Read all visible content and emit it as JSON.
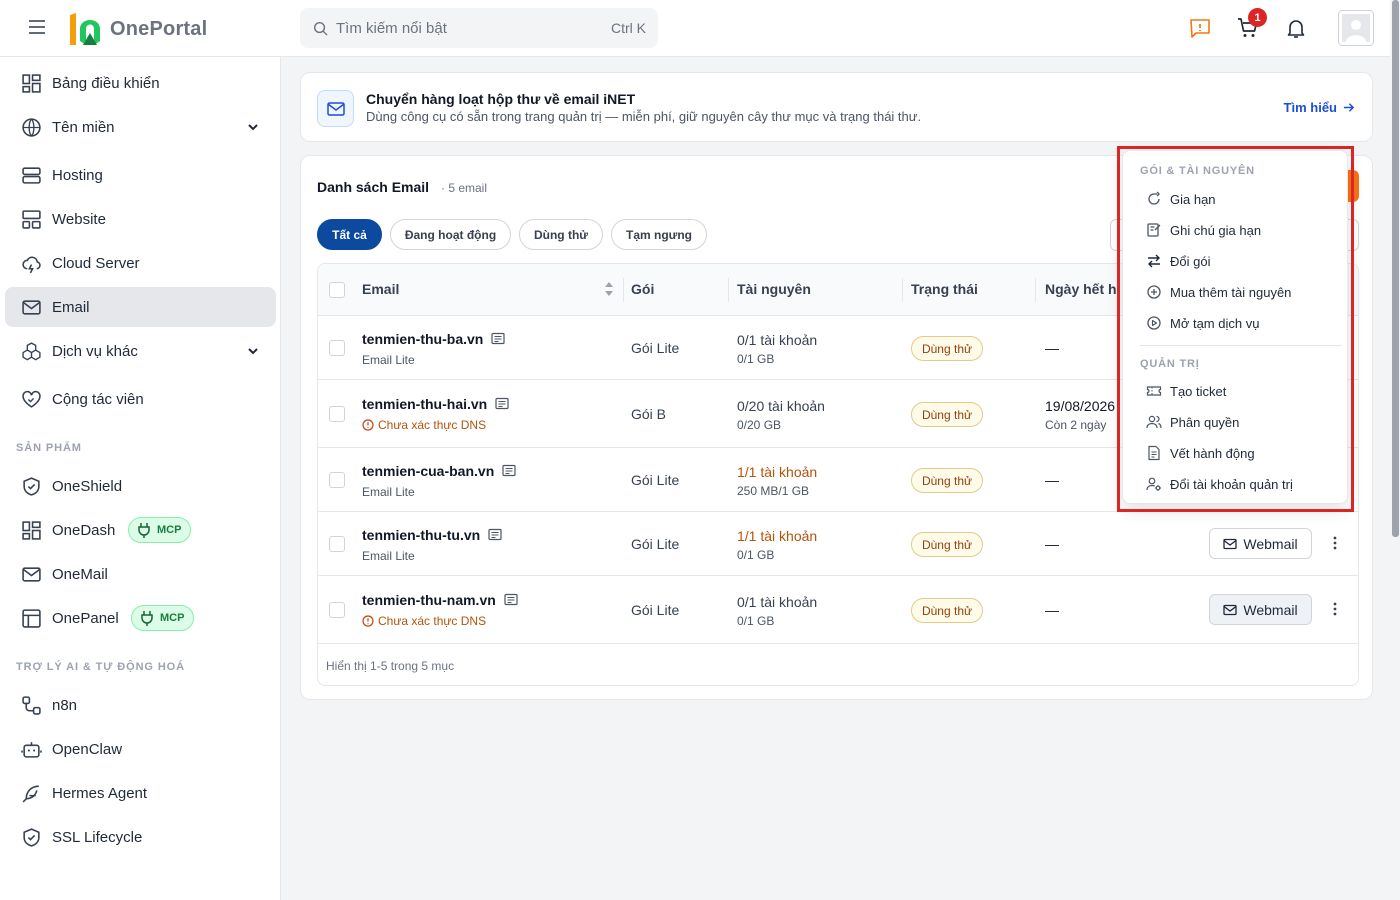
{
  "header": {
    "app_name": "OnePortal",
    "search_placeholder": "Tìm kiếm nổi bật",
    "search_shortcut": "Ctrl K",
    "cart_badge": "1"
  },
  "sidebar": {
    "items": [
      {
        "label": "Bảng điều khiển"
      },
      {
        "label": "Tên miền"
      },
      {
        "label": "Hosting"
      },
      {
        "label": "Website"
      },
      {
        "label": "Cloud Server"
      },
      {
        "label": "Email"
      },
      {
        "label": "Dịch vụ khác"
      },
      {
        "label": "Cộng tác viên"
      }
    ],
    "section_products": "SẢN PHẨM",
    "products": [
      {
        "label": "OneShield"
      },
      {
        "label": "OneDash",
        "badge": "MCP"
      },
      {
        "label": "OneMail"
      },
      {
        "label": "OnePanel",
        "badge": "MCP"
      }
    ],
    "section_ai": "TRỢ LÝ AI & TỰ ĐỘNG HOÁ",
    "ai": [
      {
        "label": "n8n"
      },
      {
        "label": "OpenClaw"
      },
      {
        "label": "Hermes Agent"
      },
      {
        "label": "SSL Lifecycle"
      }
    ]
  },
  "banner": {
    "title": "Chuyển hàng loạt hộp thư về email iNET",
    "desc": "Dùng công cụ có sẵn trong trang quản trị — miễn phí, giữ nguyên cây thư mục và trạng thái thư.",
    "link": "Tìm hiểu"
  },
  "list": {
    "title": "Danh sách Email",
    "count": "· 5 email",
    "filters": [
      "Tất cả",
      "Đang hoạt động",
      "Dùng thử",
      "Tạm ngưng"
    ],
    "columns": [
      "Email",
      "Gói",
      "Tài nguyên",
      "Trạng thái",
      "Ngày hết h"
    ],
    "rows": [
      {
        "domain": "tenmien-thu-ba.vn",
        "sub": "Email Lite",
        "warn": false,
        "plan": "Gói Lite",
        "res1": "0/1 tài khoản",
        "res1_warn": false,
        "res2": "0/1 GB",
        "status": "Dùng thử",
        "exp1": "—",
        "exp2": ""
      },
      {
        "domain": "tenmien-thu-hai.vn",
        "sub": "Chưa xác thực DNS",
        "warn": true,
        "plan": "Gói B",
        "res1": "0/20 tài khoản",
        "res1_warn": false,
        "res2": "0/20 GB",
        "status": "Dùng thử",
        "exp1": "19/08/2026",
        "exp2": "Còn 2 ngày"
      },
      {
        "domain": "tenmien-cua-ban.vn",
        "sub": "Email Lite",
        "warn": false,
        "plan": "Gói Lite",
        "res1": "1/1 tài khoản",
        "res1_warn": true,
        "res2": "250 MB/1 GB",
        "status": "Dùng thử",
        "exp1": "—",
        "exp2": ""
      },
      {
        "domain": "tenmien-thu-tu.vn",
        "sub": "Email Lite",
        "warn": false,
        "plan": "Gói Lite",
        "res1": "1/1 tài khoản",
        "res1_warn": true,
        "res2": "0/1 GB",
        "status": "Dùng thử",
        "exp1": "—",
        "exp2": ""
      },
      {
        "domain": "tenmien-thu-nam.vn",
        "sub": "Chưa xác thực DNS",
        "warn": true,
        "plan": "Gói Lite",
        "res1": "0/1 tài khoản",
        "res1_warn": false,
        "res2": "0/1 GB",
        "status": "Dùng thử",
        "exp1": "—",
        "exp2": ""
      }
    ],
    "webmail_label": "Webmail",
    "footer": "Hiển thị 1-5 trong 5 mục"
  },
  "menu": {
    "section1": "GÓI & TÀI NGUYÊN",
    "items1": [
      "Gia hạn",
      "Ghi chú gia hạn",
      "Đổi gói",
      "Mua thêm tài nguyên",
      "Mở tạm dịch vụ"
    ],
    "section2": "QUẢN TRỊ",
    "items2": [
      "Tạo ticket",
      "Phân quyền",
      "Vết hành động",
      "Đổi tài khoản quản trị"
    ]
  }
}
